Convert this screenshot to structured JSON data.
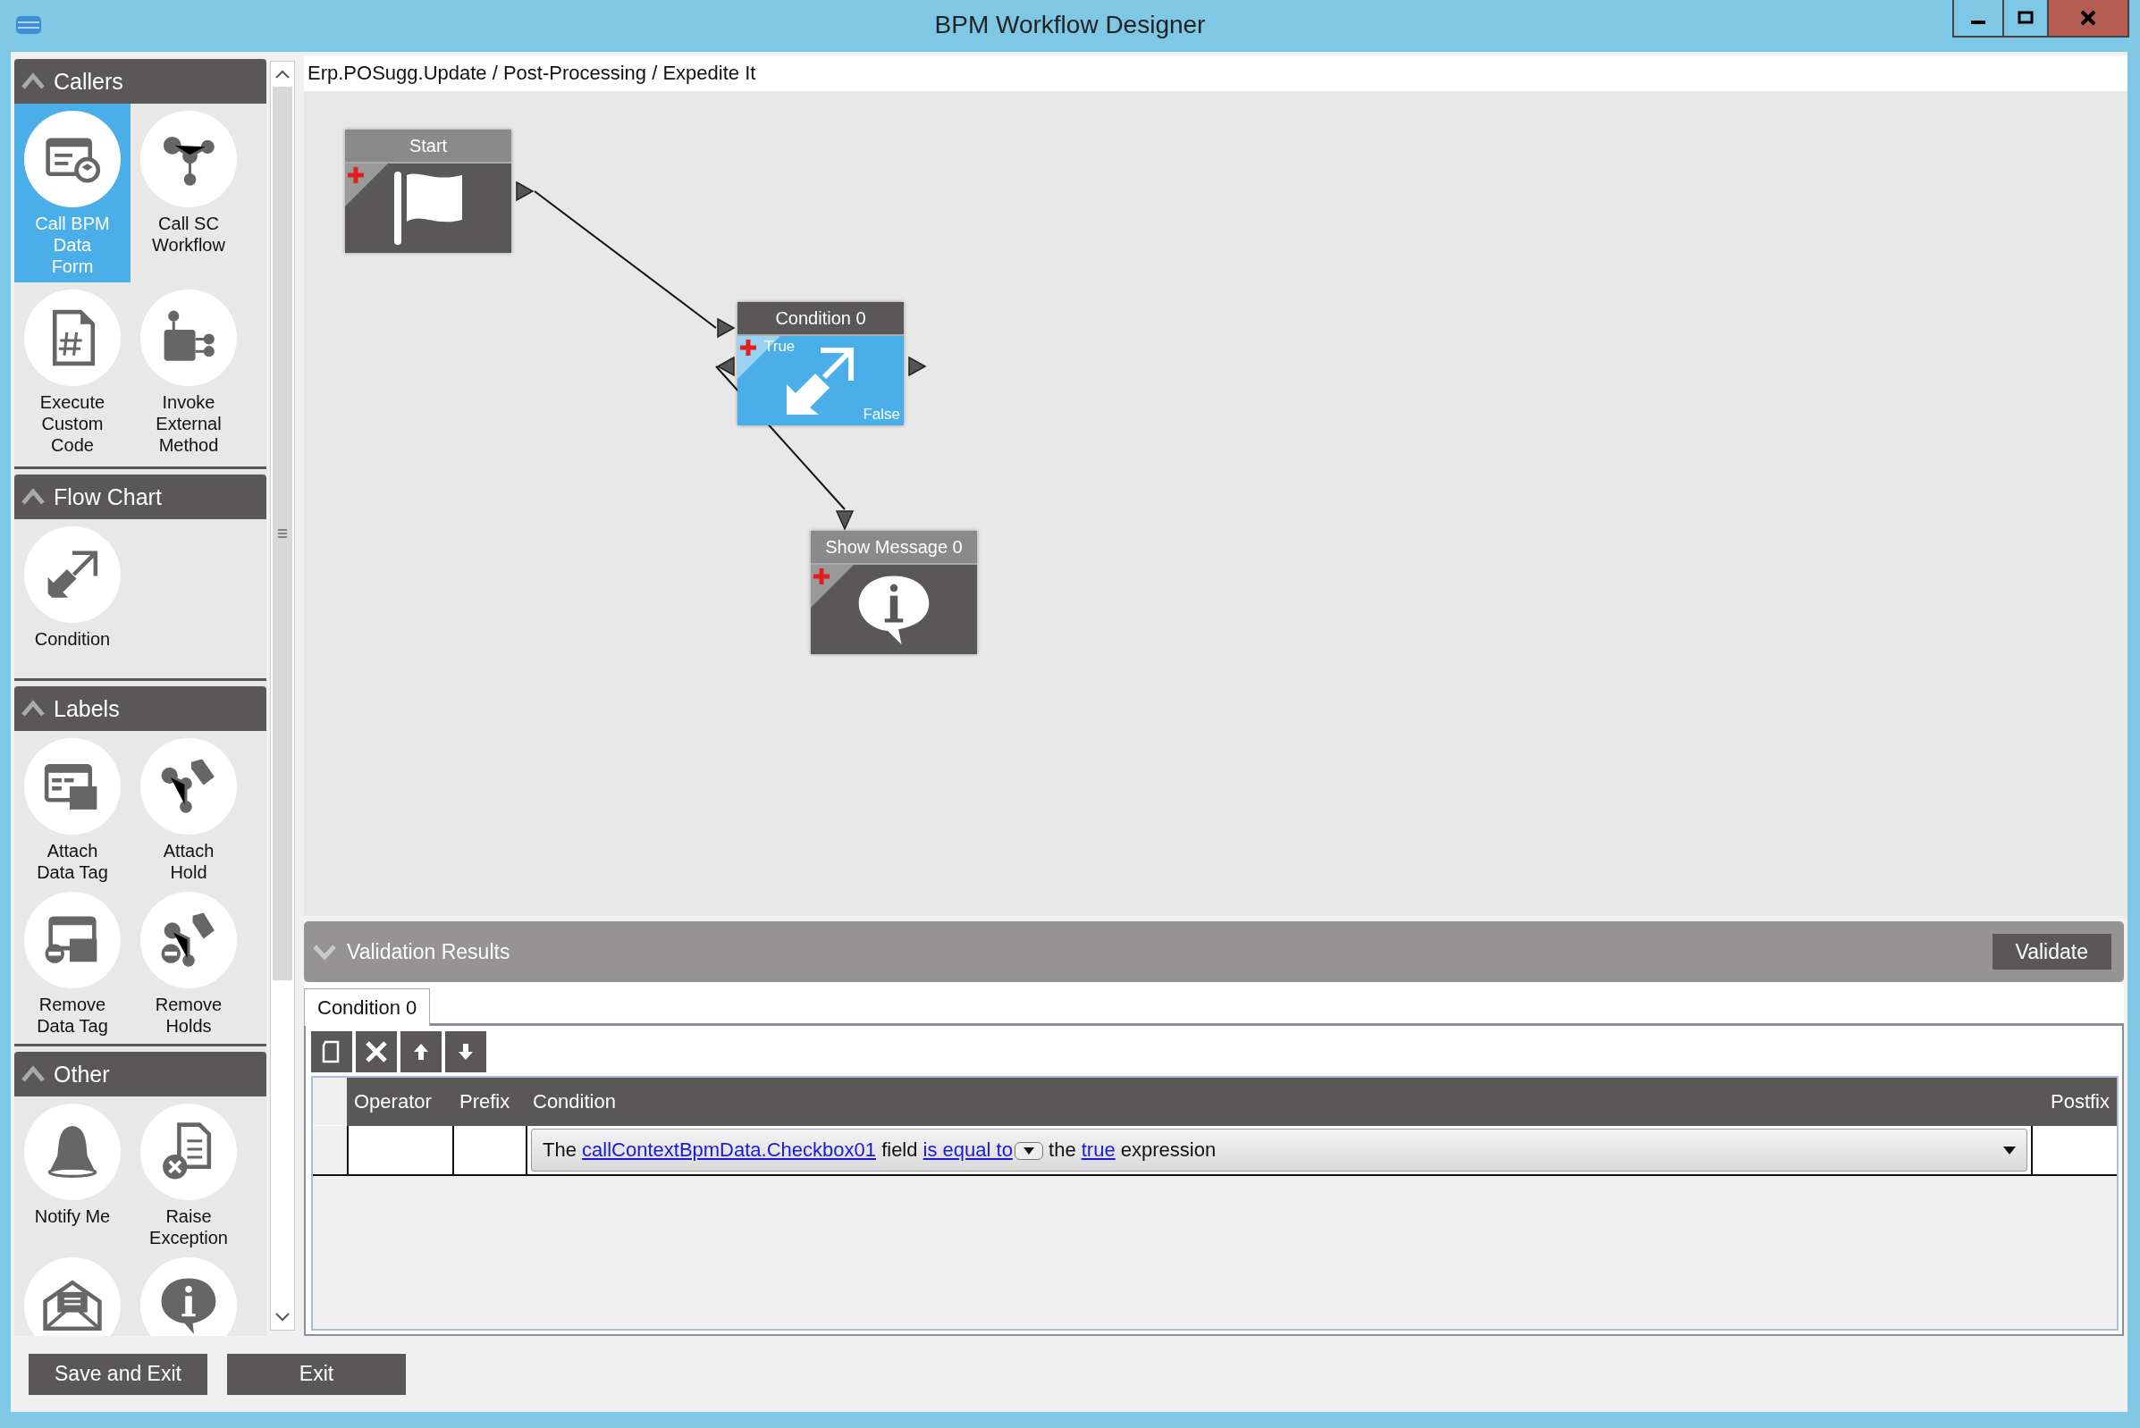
{
  "window": {
    "title": "BPM Workflow Designer"
  },
  "palette": {
    "sections": [
      {
        "title": "Callers",
        "expanded": true,
        "items": [
          {
            "label": "Call BPM\nData\nForm",
            "selected": true
          },
          {
            "label": "Call SC\nWorkflow",
            "selected": false
          },
          {
            "label": "Execute\nCustom\nCode",
            "selected": false
          },
          {
            "label": "Invoke\nExternal\nMethod",
            "selected": false
          }
        ]
      },
      {
        "title": "Flow Chart",
        "expanded": true,
        "items": [
          {
            "label": "Condition",
            "selected": false
          }
        ]
      },
      {
        "title": "Labels",
        "expanded": true,
        "items": [
          {
            "label": "Attach\nData Tag",
            "selected": false
          },
          {
            "label": "Attach\nHold",
            "selected": false
          },
          {
            "label": "Remove\nData Tag",
            "selected": false
          },
          {
            "label": "Remove\nHolds",
            "selected": false
          }
        ]
      },
      {
        "title": "Other",
        "expanded": true,
        "items": [
          {
            "label": "Notify Me",
            "selected": false
          },
          {
            "label": "Raise\nException",
            "selected": false
          },
          {
            "selected": false
          },
          {
            "selected": false
          }
        ]
      }
    ]
  },
  "breadcrumb": "Erp.POSugg.Update / Post-Processing / Expedite It",
  "canvas": {
    "nodes": [
      {
        "title": "Start",
        "kind": "start",
        "selected": false
      },
      {
        "title": "Condition 0",
        "kind": "condition",
        "selected": true,
        "true_label": "True",
        "false_label": "False"
      },
      {
        "title": "Show Message 0",
        "kind": "message",
        "selected": false
      }
    ]
  },
  "validation": {
    "title": "Validation Results",
    "expanded": true,
    "button": "Validate",
    "tabs": [
      {
        "label": "Condition 0",
        "selected": true
      }
    ],
    "columns": [
      "Operator",
      "Prefix",
      "Condition",
      "Postfix"
    ],
    "rows": [
      {
        "condition": [
          {
            "text": "The",
            "link": false
          },
          {
            "text": "callContextBpmData.Checkbox01",
            "link": true
          },
          {
            "text": "field",
            "link": false
          },
          {
            "text": "is equal to",
            "link": true,
            "dropdown": true
          },
          {
            "text": "the",
            "link": false
          },
          {
            "text": "true",
            "link": true
          },
          {
            "text": "expression",
            "link": false
          }
        ]
      }
    ]
  },
  "footer": {
    "buttons": [
      "Save and Exit",
      "Exit"
    ]
  }
}
